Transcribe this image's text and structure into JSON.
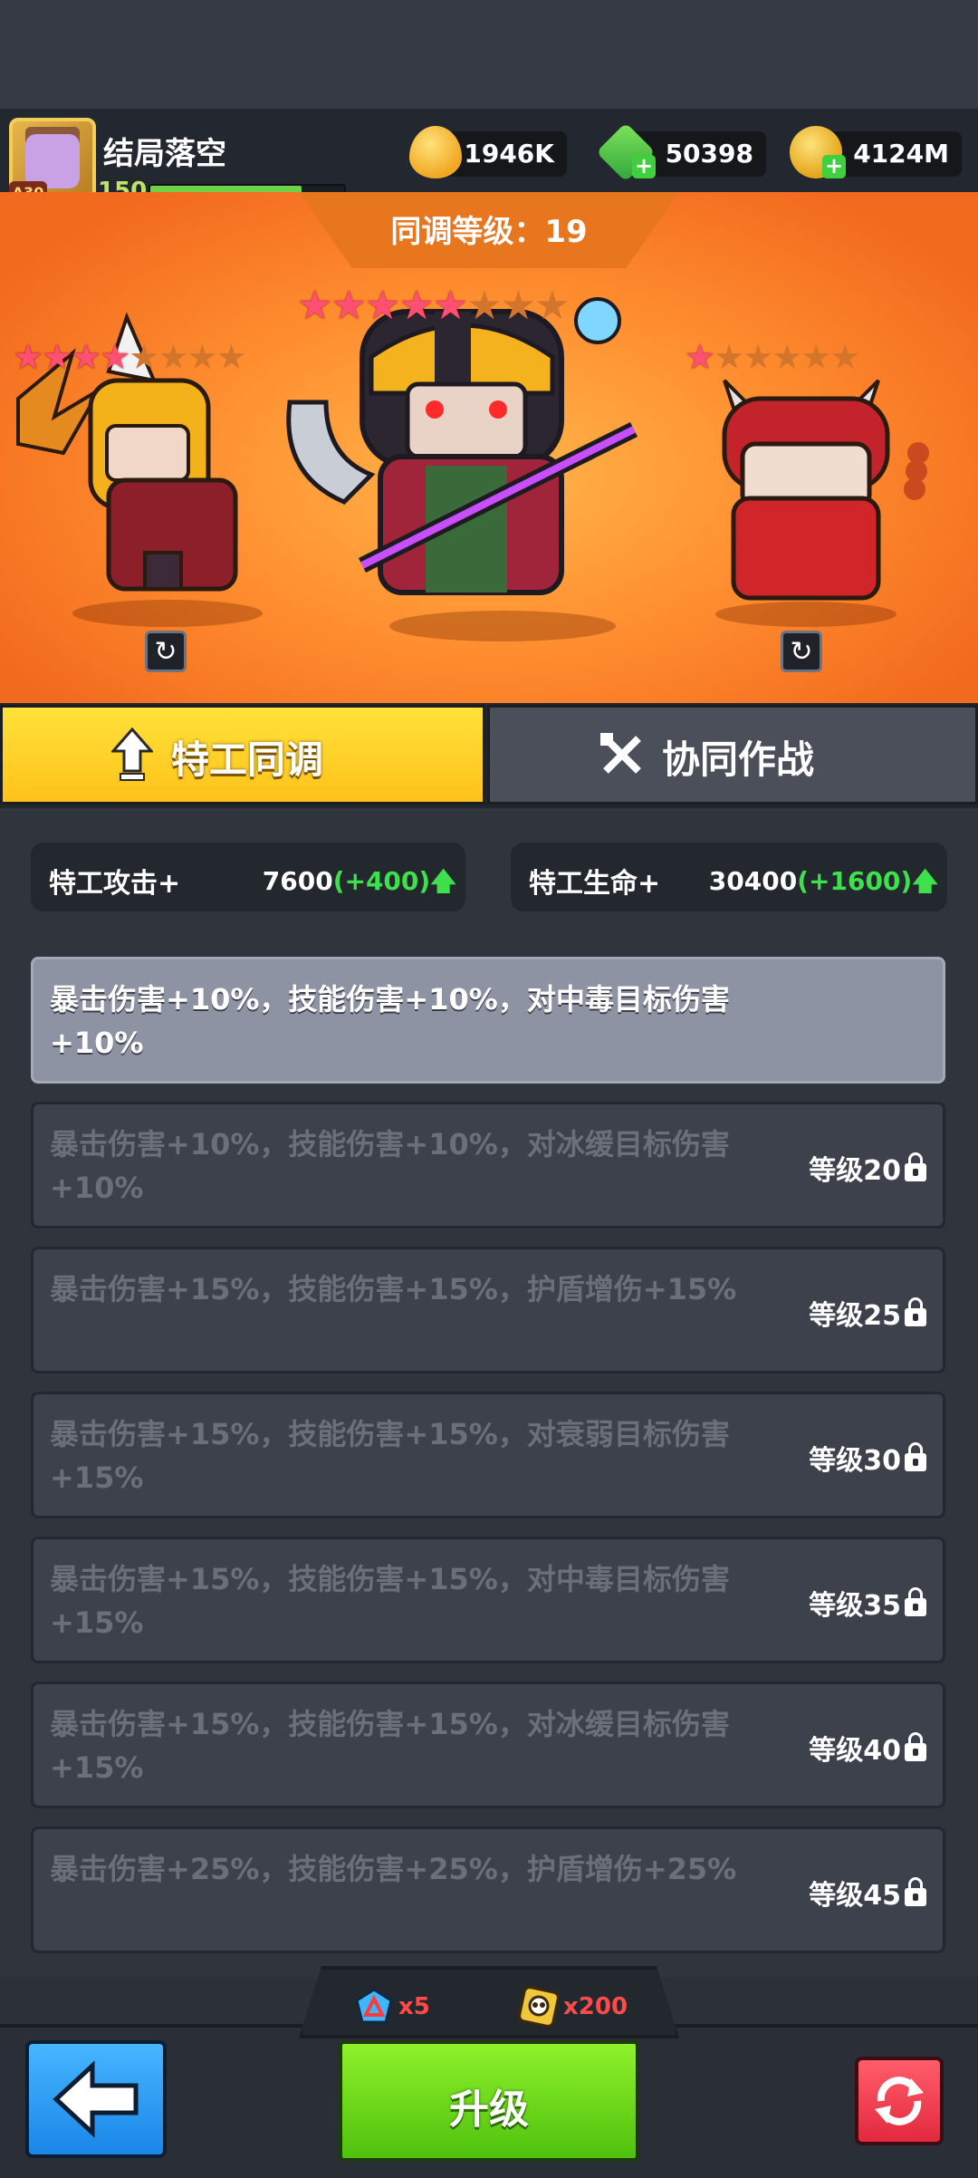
{
  "player": {
    "name": "结局落空",
    "level": "150",
    "badge": "A30",
    "xp_fraction": 0.78
  },
  "resources": {
    "oil": "1946K",
    "gems": "50398",
    "coins": "4124M"
  },
  "sync": {
    "level_text": "同调等级：19"
  },
  "heroes": [
    {
      "position": "left",
      "stars_on": 4,
      "stars_total": 8
    },
    {
      "position": "center",
      "stars_on": 5,
      "stars_total": 8
    },
    {
      "position": "right",
      "stars_on": 1,
      "stars_total": 6
    }
  ],
  "tabs": [
    {
      "label": "特工同调",
      "active": true
    },
    {
      "label": "协同作战",
      "active": false
    }
  ],
  "stats": [
    {
      "label": "特工攻击+",
      "value": "7600",
      "increase": "(+400)"
    },
    {
      "label": "特工生命+",
      "value": "30400",
      "increase": "(+1600)"
    }
  ],
  "bonuses": [
    {
      "text": "暴击伤害+10%，技能伤害+10%，对中毒目标伤害+10%",
      "requirement": "",
      "locked": false
    },
    {
      "text": "暴击伤害+10%，技能伤害+10%，对冰缓目标伤害+10%",
      "requirement": "等级20",
      "locked": true
    },
    {
      "text": "暴击伤害+15%，技能伤害+15%，护盾增伤+15%",
      "requirement": "等级25",
      "locked": true
    },
    {
      "text": "暴击伤害+15%，技能伤害+15%，对衰弱目标伤害+15%",
      "requirement": "等级30",
      "locked": true
    },
    {
      "text": "暴击伤害+15%，技能伤害+15%，对中毒目标伤害+15%",
      "requirement": "等级35",
      "locked": true
    },
    {
      "text": "暴击伤害+15%，技能伤害+15%，对冰缓目标伤害+15%",
      "requirement": "等级40",
      "locked": true
    },
    {
      "text": "暴击伤害+25%，技能伤害+25%，护盾增伤+25%",
      "requirement": "等级45",
      "locked": true
    }
  ],
  "costs": [
    {
      "icon": "shield-token-icon",
      "amount": "x5"
    },
    {
      "icon": "skull-token-icon",
      "amount": "x200"
    }
  ],
  "buttons": {
    "upgrade": "升级"
  },
  "colors": {
    "active_tab": "#ffd22a",
    "upgrade": "#6fd81c",
    "increase": "#3ee04c",
    "cost": "#ff4a4a"
  }
}
